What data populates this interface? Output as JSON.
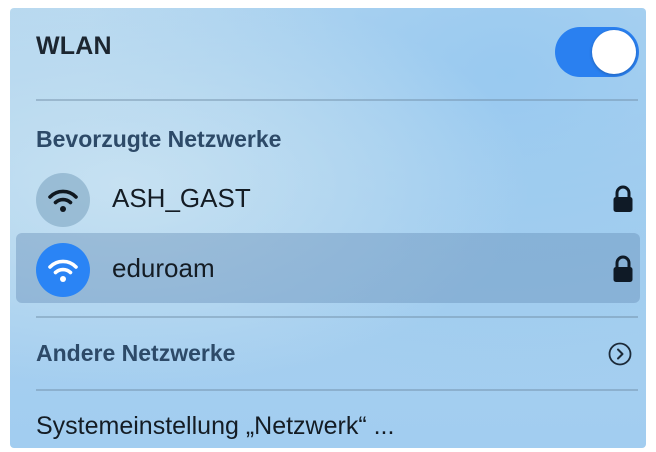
{
  "header": {
    "title": "WLAN",
    "toggle_on": true,
    "accent_color": "#2a80f0"
  },
  "preferred": {
    "title": "Bevorzugte Netzwerke",
    "networks": [
      {
        "name": "ASH_GAST",
        "icon": "wifi-icon",
        "secured": true,
        "connected": false
      },
      {
        "name": "eduroam",
        "icon": "wifi-icon",
        "secured": true,
        "connected": true
      }
    ]
  },
  "other": {
    "title": "Andere Netzwerke",
    "icon": "chevron-right-circle-icon"
  },
  "settings": {
    "label": "Systemeinstellung „Netzwerk“ ..."
  }
}
